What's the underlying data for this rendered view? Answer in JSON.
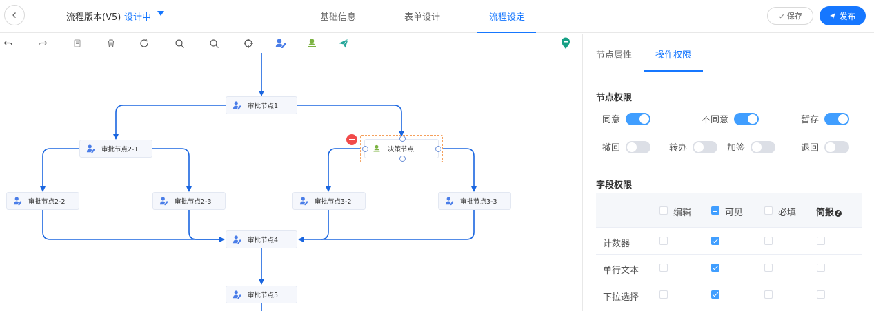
{
  "header": {
    "version_title": "流程版本(V5)",
    "version_status": "设计中",
    "tabs": [
      {
        "label": "基础信息"
      },
      {
        "label": "表单设计"
      },
      {
        "label": "流程设定"
      }
    ],
    "active_tab": "流程设定",
    "save_label": "保存",
    "publish_label": "发布"
  },
  "toolbar": {
    "icons": [
      "undo-icon",
      "redo-icon",
      "copy-icon",
      "delete-icon",
      "refresh-icon",
      "zoom-in-icon",
      "zoom-out-icon",
      "locate-icon",
      "add-approver-icon",
      "add-decision-icon",
      "send-icon",
      "location-pin-icon"
    ]
  },
  "flow": {
    "nodes": [
      {
        "label": "审批节点1"
      },
      {
        "label": "审批节点2-1"
      },
      {
        "label": "决策节点"
      },
      {
        "label": "审批节点2-2"
      },
      {
        "label": "审批节点2-3"
      },
      {
        "label": "审批节点3-2"
      },
      {
        "label": "审批节点3-3"
      },
      {
        "label": "审批节点4"
      },
      {
        "label": "审批节点5"
      }
    ]
  },
  "panel": {
    "tabs": [
      {
        "label": "节点属性"
      },
      {
        "label": "操作权限"
      }
    ],
    "active_tab": "操作权限",
    "node_perm_title": "节点权限",
    "node_perms": [
      {
        "label": "同意",
        "on": true
      },
      {
        "label": "不同意",
        "on": true
      },
      {
        "label": "暂存",
        "on": true
      },
      {
        "label": "撤回",
        "on": false
      },
      {
        "label": "转办",
        "on": false
      },
      {
        "label": "加签",
        "on": false
      },
      {
        "label": "退回",
        "on": false
      }
    ],
    "field_perm_title": "字段权限",
    "field_headers": {
      "edit": "编辑",
      "visible": "可见",
      "required": "必填",
      "brief": "简报"
    },
    "fields": [
      {
        "name": "计数器",
        "edit": false,
        "visible": true,
        "required": false,
        "brief": false
      },
      {
        "name": "单行文本",
        "edit": false,
        "visible": true,
        "required": false,
        "brief": false
      },
      {
        "name": "下拉选择",
        "edit": false,
        "visible": true,
        "required": false,
        "brief": false
      }
    ]
  },
  "colors": {
    "accent": "#1677ff",
    "switch_on": "#409eff",
    "approver_icon": "#4a7de8",
    "decision_icon": "#7cb342",
    "danger": "#f14a4a",
    "selection": "#f5a05c"
  }
}
